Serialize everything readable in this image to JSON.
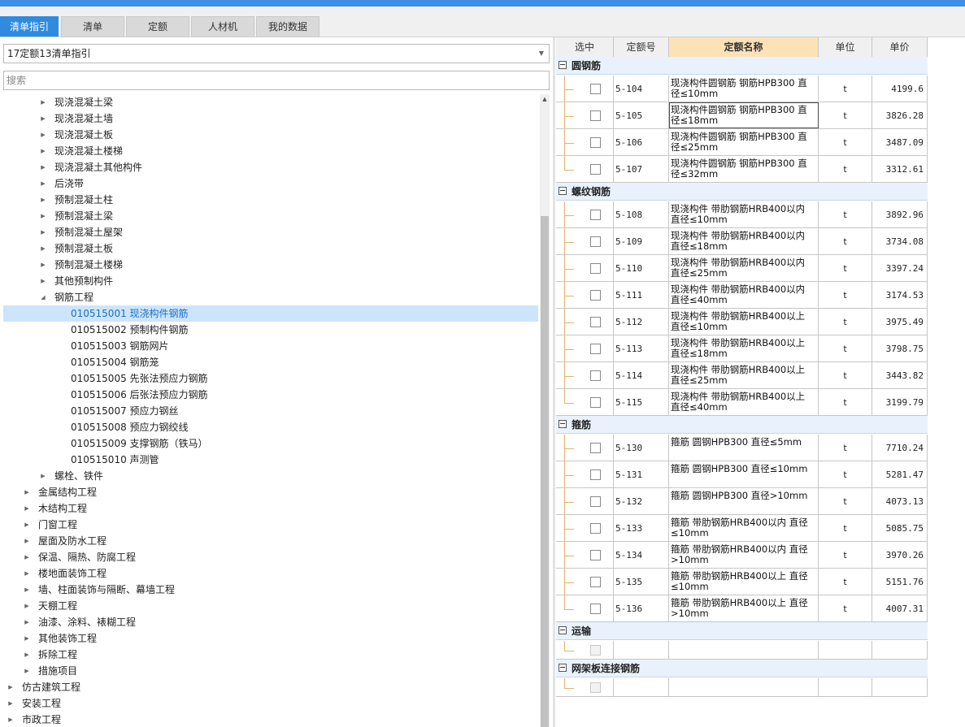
{
  "tabs": [
    "清单指引",
    "清单",
    "定额",
    "人材机",
    "我的数据"
  ],
  "left": {
    "selector_value": "17定额13清单指引",
    "search_placeholder": "搜索",
    "tree": [
      {
        "label": "现浇混凝土梁",
        "expanded": false
      },
      {
        "label": "现浇混凝土墙",
        "expanded": false
      },
      {
        "label": "现浇混凝土板",
        "expanded": false
      },
      {
        "label": "现浇混凝土楼梯",
        "expanded": false
      },
      {
        "label": "现浇混凝土其他构件",
        "expanded": false
      },
      {
        "label": "后浇带",
        "expanded": false
      },
      {
        "label": "预制混凝土柱",
        "expanded": false
      },
      {
        "label": "预制混凝土梁",
        "expanded": false
      },
      {
        "label": "预制混凝土屋架",
        "expanded": false
      },
      {
        "label": "预制混凝土板",
        "expanded": false
      },
      {
        "label": "预制混凝土楼梯",
        "expanded": false
      },
      {
        "label": "其他预制构件",
        "expanded": false
      },
      {
        "label": "钢筋工程",
        "expanded": true
      },
      {
        "label": "010515001  现浇构件钢筋",
        "selected": true
      },
      {
        "label": "010515002  预制构件钢筋"
      },
      {
        "label": "010515003  钢筋网片"
      },
      {
        "label": "010515004  钢筋笼"
      },
      {
        "label": "010515005  先张法预应力钢筋"
      },
      {
        "label": "010515006  后张法预应力钢筋"
      },
      {
        "label": "010515007  预应力钢丝"
      },
      {
        "label": "010515008  预应力钢绞线"
      },
      {
        "label": "010515009  支撑钢筋（铁马）"
      },
      {
        "label": "010515010  声测管"
      },
      {
        "label": "螺栓、铁件",
        "expanded": false
      },
      {
        "label": "金属结构工程",
        "expanded": false
      },
      {
        "label": "木结构工程",
        "expanded": false
      },
      {
        "label": "门窗工程",
        "expanded": false
      },
      {
        "label": "屋面及防水工程",
        "expanded": false
      },
      {
        "label": "保温、隔热、防腐工程",
        "expanded": false
      },
      {
        "label": "楼地面装饰工程",
        "expanded": false
      },
      {
        "label": "墙、柱面装饰与隔断、幕墙工程",
        "expanded": false
      },
      {
        "label": "天棚工程",
        "expanded": false
      },
      {
        "label": "油漆、涂料、裱糊工程",
        "expanded": false
      },
      {
        "label": "其他装饰工程",
        "expanded": false
      },
      {
        "label": "拆除工程",
        "expanded": false
      },
      {
        "label": "措施项目",
        "expanded": false
      },
      {
        "label": "仿古建筑工程",
        "expanded": false
      },
      {
        "label": "安装工程",
        "expanded": false
      },
      {
        "label": "市政工程",
        "expanded": false
      }
    ]
  },
  "grid": {
    "columns": [
      "选中",
      "定额号",
      "定额名称",
      "单位",
      "单价"
    ],
    "groups": [
      {
        "title": "圆钢筋",
        "rows": [
          {
            "code": "5-104",
            "name": "现浇构件圆钢筋 钢筋HPB300 直径≤10mm",
            "unit": "t",
            "price": "4199.6"
          },
          {
            "code": "5-105",
            "name": "现浇构件圆钢筋 钢筋HPB300 直径≤18mm",
            "unit": "t",
            "price": "3826.28"
          },
          {
            "code": "5-106",
            "name": "现浇构件圆钢筋 钢筋HPB300 直径≤25mm",
            "unit": "t",
            "price": "3487.09"
          },
          {
            "code": "5-107",
            "name": "现浇构件圆钢筋 钢筋HPB300 直径≤32mm",
            "unit": "t",
            "price": "3312.61"
          }
        ]
      },
      {
        "title": "螺纹钢筋",
        "rows": [
          {
            "code": "5-108",
            "name": "现浇构件 带肋钢筋HRB400以内 直径≤10mm",
            "unit": "t",
            "price": "3892.96"
          },
          {
            "code": "5-109",
            "name": "现浇构件 带肋钢筋HRB400以内 直径≤18mm",
            "unit": "t",
            "price": "3734.08"
          },
          {
            "code": "5-110",
            "name": "现浇构件 带肋钢筋HRB400以内 直径≤25mm",
            "unit": "t",
            "price": "3397.24"
          },
          {
            "code": "5-111",
            "name": "现浇构件 带肋钢筋HRB400以内 直径≤40mm",
            "unit": "t",
            "price": "3174.53"
          },
          {
            "code": "5-112",
            "name": "现浇构件 带肋钢筋HRB400以上 直径≤10mm",
            "unit": "t",
            "price": "3975.49"
          },
          {
            "code": "5-113",
            "name": "现浇构件 带肋钢筋HRB400以上 直径≤18mm",
            "unit": "t",
            "price": "3798.75"
          },
          {
            "code": "5-114",
            "name": "现浇构件 带肋钢筋HRB400以上 直径≤25mm",
            "unit": "t",
            "price": "3443.82"
          },
          {
            "code": "5-115",
            "name": "现浇构件 带肋钢筋HRB400以上 直径≤40mm",
            "unit": "t",
            "price": "3199.79"
          }
        ]
      },
      {
        "title": "箍筋",
        "rows": [
          {
            "code": "5-130",
            "name": "箍筋 圆钢HPB300 直径≤5mm",
            "unit": "t",
            "price": "7710.24"
          },
          {
            "code": "5-131",
            "name": "箍筋 圆钢HPB300 直径≤10mm",
            "unit": "t",
            "price": "5281.47"
          },
          {
            "code": "5-132",
            "name": "箍筋 圆钢HPB300 直径>10mm",
            "unit": "t",
            "price": "4073.13"
          },
          {
            "code": "5-133",
            "name": "箍筋 带肋钢筋HRB400以内 直径≤10mm",
            "unit": "t",
            "price": "5085.75"
          },
          {
            "code": "5-134",
            "name": "箍筋 带肋钢筋HRB400以内 直径>10mm",
            "unit": "t",
            "price": "3970.26"
          },
          {
            "code": "5-135",
            "name": "箍筋 带肋钢筋HRB400以上 直径≤10mm",
            "unit": "t",
            "price": "5151.76"
          },
          {
            "code": "5-136",
            "name": "箍筋 带肋钢筋HRB400以上 直径>10mm",
            "unit": "t",
            "price": "4007.31"
          }
        ]
      },
      {
        "title": "运输",
        "rows": [
          {
            "code": "",
            "name": "",
            "unit": "",
            "price": "",
            "disabled": true
          }
        ]
      },
      {
        "title": "网架板连接钢筋",
        "rows": [
          {
            "code": "",
            "name": "",
            "unit": "",
            "price": "",
            "disabled": true
          }
        ]
      }
    ]
  }
}
